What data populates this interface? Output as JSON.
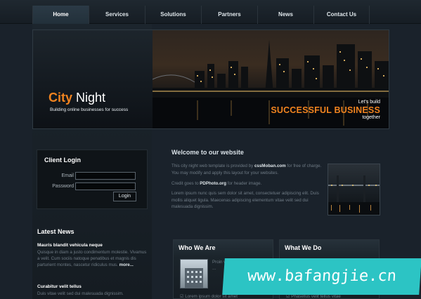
{
  "nav": {
    "items": [
      "Home",
      "Services",
      "Solutions",
      "Partners",
      "News",
      "Contact Us"
    ],
    "active": "Home"
  },
  "header": {
    "logo_word1": "City",
    "logo_word2": "Night",
    "tagline": "Building online businesses for success",
    "banner_line1": "Let's build",
    "banner_line2": "SUCCESSFUL BUSINESS",
    "banner_line3": "together"
  },
  "login": {
    "title": "Client Login",
    "email_label": "Email",
    "password_label": "Password",
    "button_label": "Login"
  },
  "news": {
    "title": "Latest News",
    "items": [
      {
        "title": "Mauris blandit vehicula neque",
        "body": "Quisque in diam a justo condimentum molestie. Vivamus a velit. Cum sociis natoque penatibus et magnis dis parturient montes, nascetur ridiculus mus.",
        "more": "more..."
      },
      {
        "title": "Curabitur velit tellus",
        "body": "Duis vitae velit sed dui malesuada dignissim."
      }
    ]
  },
  "welcome": {
    "title": "Welcome to our website",
    "p1_a": "This city night web template is provided by ",
    "p1_link": "cssMoban.com",
    "p1_b": " for free of charge. You may modify and apply this layout for your websites.",
    "p2_a": "Credit goes to ",
    "p2_link": "PDPhoto.org",
    "p2_b": " for header image.",
    "p3": "Lorem ipsum nunc quis sem dolor sit amet, consectetuer adipiscing elit. Duis mollis aliquet ligula. Maecenas adipiscing elementum vitae velit sed dui malesuada dignissim."
  },
  "boxes": [
    {
      "title": "Who We Are",
      "text": "Proin vestibulum venenatis ...",
      "check": "Lorem ipsum dolor sit amet"
    },
    {
      "title": "What We Do",
      "text": "",
      "check": "Phasellus velit tellus vitae"
    }
  ],
  "watermark": "www.bafangjie.cn",
  "colors": {
    "accent": "#f0831f",
    "background": "#1a222b",
    "watermark": "#2cc4c4"
  }
}
